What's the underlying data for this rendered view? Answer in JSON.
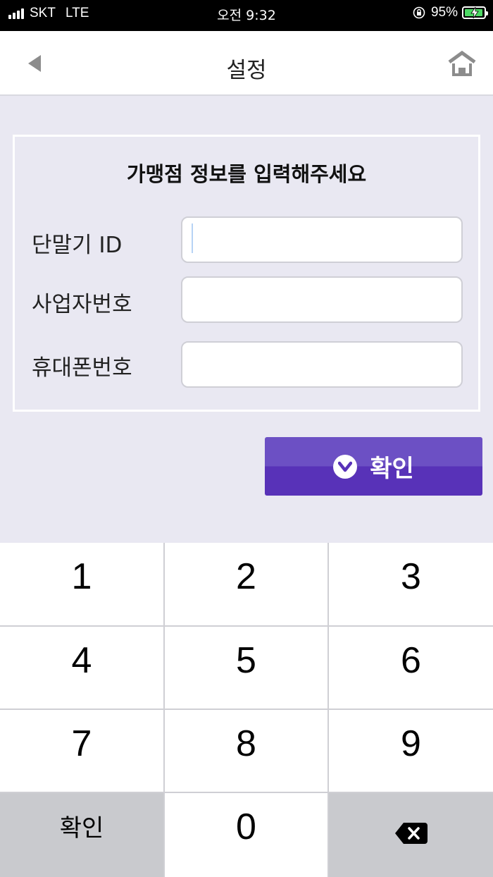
{
  "status_bar": {
    "carrier": "SKT",
    "network": "LTE",
    "time": "오전 9:32",
    "battery": "95%"
  },
  "header": {
    "title": "설정",
    "back_icon": "back-arrow-icon",
    "home_icon": "home-icon"
  },
  "form": {
    "heading": "가맹점 정보를 입력해주세요",
    "fields": [
      {
        "label": "단말기 ID",
        "value": "",
        "placeholder": ""
      },
      {
        "label": "사업자번호",
        "value": "",
        "placeholder": ""
      },
      {
        "label": "휴대폰번호",
        "value": "",
        "placeholder": ""
      }
    ]
  },
  "confirm_button": {
    "label": "확인",
    "icon": "check-circle-icon",
    "color_top": "#6c50c4",
    "color_bottom": "#5832b8"
  },
  "keypad": {
    "keys": [
      "1",
      "2",
      "3",
      "4",
      "5",
      "6",
      "7",
      "8",
      "9"
    ],
    "confirm_label": "확인",
    "zero": "0",
    "backspace_icon": "backspace-icon"
  }
}
